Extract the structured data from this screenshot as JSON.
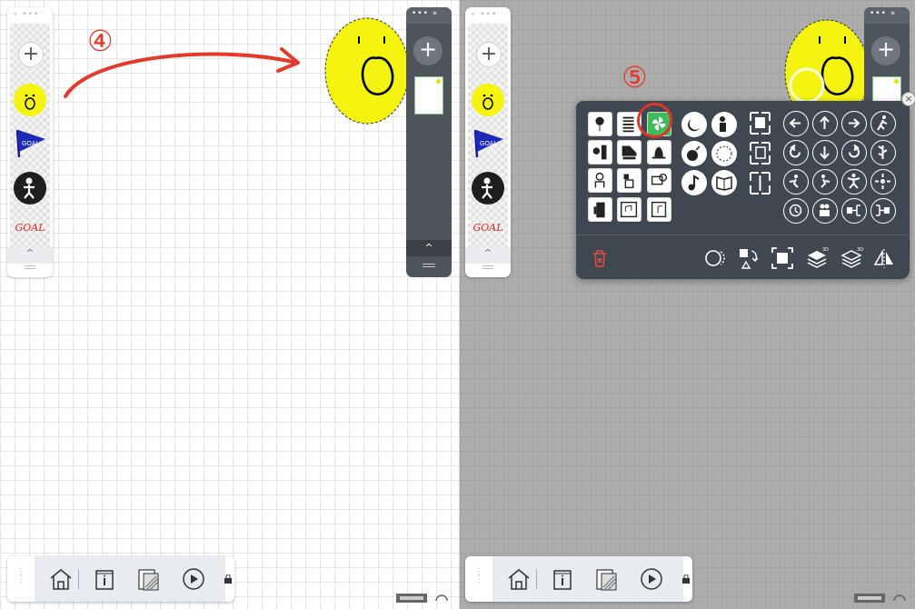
{
  "annotations": {
    "step4": "④",
    "step5": "⑤"
  },
  "left_panel": {
    "tray": {
      "dots": "« •••",
      "add_label": "+",
      "collapse": "^",
      "pages": [
        "yellow-face",
        "goal-flag",
        "runner-sign",
        "goal-text"
      ]
    },
    "goal_text": "GOAL",
    "flag_text": "GOAL",
    "side_tray": {
      "dots": "••• »",
      "add_label": "+",
      "collapse": "^"
    }
  },
  "right_panel": {
    "tray": {
      "dots": "« •••",
      "add_label": "+",
      "collapse": "^"
    },
    "goal_text": "GOAL",
    "flag_text": "GOAL",
    "side_tray": {
      "dots": "••• »",
      "add_label": "+",
      "collapse": "^"
    },
    "palette": {
      "close_label": "×",
      "square_icons": [
        "balloon-icon",
        "spring-icon",
        "pinwheel-icon",
        "sun-figure-icon",
        "piano-icon",
        "bell-icon",
        "astronaut-icon",
        "robot-icon",
        "camera-icon",
        "door-icon",
        "music-box-icon",
        "note-card-icon"
      ],
      "circle_icons": [
        "moon-icon",
        "person-icon",
        "bomb-icon",
        "clock-icon",
        "note-icon",
        "book-icon"
      ],
      "frame_icons": [
        "frame-out-icon",
        "frame-in-icon",
        "frame-split-icon"
      ],
      "action_icons": [
        "arrow-left-icon",
        "arrow-up-icon",
        "arrow-right-icon",
        "run-icon",
        "rotate-left-icon",
        "arrow-down-icon",
        "rotate-right-icon",
        "tree-icon",
        "jump-left-icon",
        "jump-right-icon",
        "star-jump-icon",
        "spin-icon",
        "dizzy-icon",
        "hug-icon",
        "branch-out-icon",
        "branch-in-icon"
      ],
      "tools": [
        "delete-icon",
        "ellipse-toggle-icon",
        "shape-swap-icon",
        "fit-icon",
        "layer-3d-up-icon",
        "layer-3d-down-icon",
        "flip-icon"
      ],
      "badge_3d": "3D"
    }
  },
  "bottom_toolbar": {
    "buttons": [
      "home-icon",
      "info-icon",
      "pages-icon",
      "play-icon"
    ]
  },
  "colors": {
    "accent_red": "#e3342a",
    "palette_bg": "#3f4750",
    "highlight_green": "#3dbd57",
    "face_yellow": "#f4f410"
  }
}
